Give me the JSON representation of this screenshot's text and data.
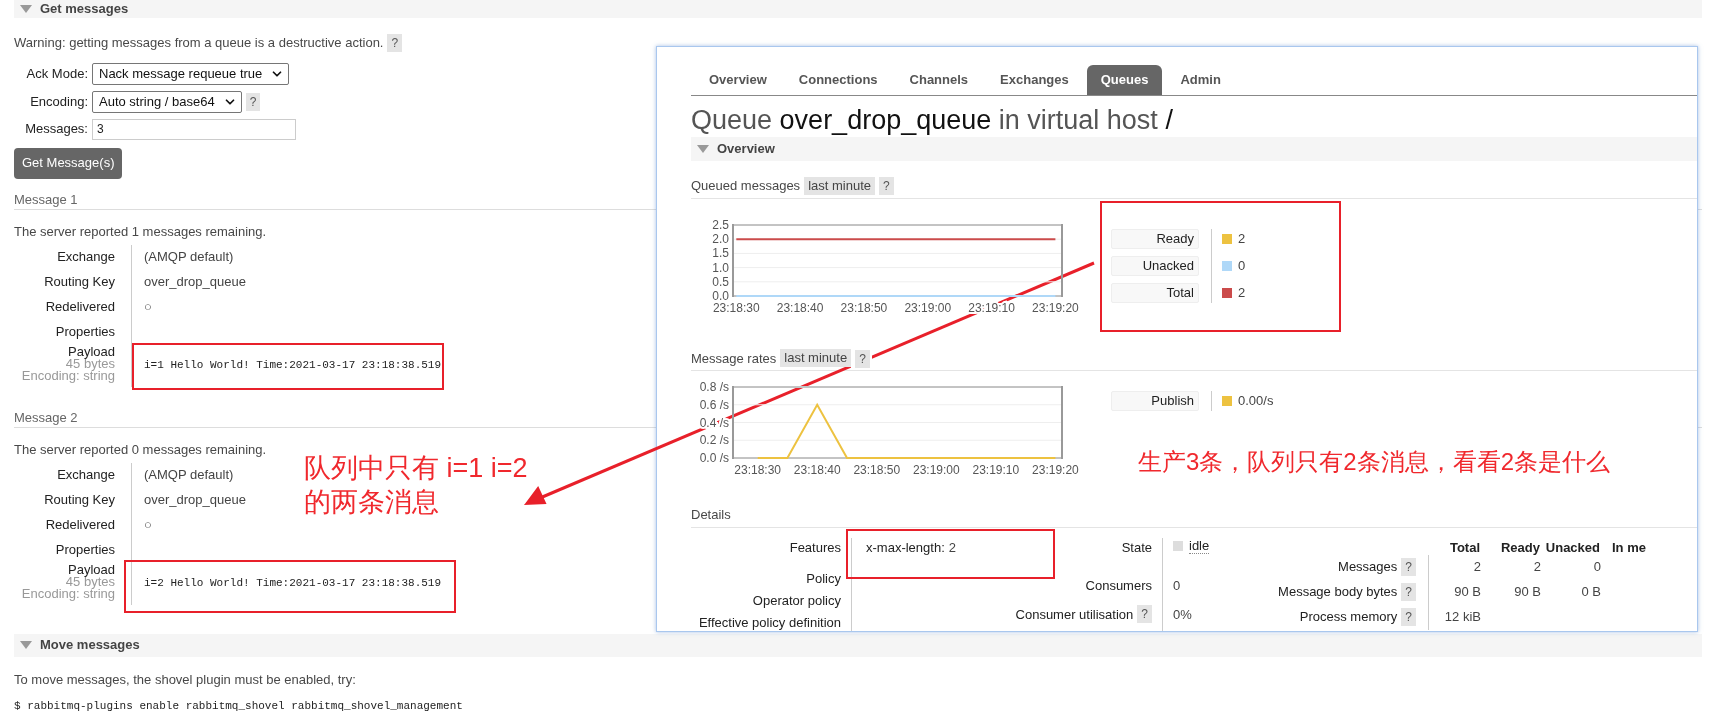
{
  "get_messages": {
    "section_title": "Get messages",
    "warning": "Warning: getting messages from a queue is a destructive action.",
    "warning_help": "?",
    "ack_mode": {
      "label": "Ack Mode:",
      "value": "Nack message requeue true"
    },
    "encoding": {
      "label": "Encoding:",
      "value": "Auto string / base64",
      "help": "?"
    },
    "messages": {
      "label": "Messages:",
      "value": "3"
    },
    "button": "Get Message(s)",
    "results": [
      {
        "title": "Message 1",
        "remaining": "The server reported 1 messages remaining.",
        "fields": [
          {
            "label": "Exchange",
            "value": "(AMQP default)"
          },
          {
            "label": "Routing Key",
            "value": "over_drop_queue"
          },
          {
            "label": "Redelivered",
            "value": "○"
          },
          {
            "label": "Properties"
          }
        ],
        "payload": {
          "label": "Payload",
          "size": "45 bytes",
          "encoding": "Encoding: string",
          "value": "i=1 Hello World! Time:2021-03-17 23:18:38.519"
        }
      },
      {
        "title": "Message 2",
        "remaining": "The server reported 0 messages remaining.",
        "fields": [
          {
            "label": "Exchange",
            "value": "(AMQP default)"
          },
          {
            "label": "Routing Key",
            "value": "over_drop_queue"
          },
          {
            "label": "Redelivered",
            "value": "○"
          },
          {
            "label": "Properties"
          }
        ],
        "payload": {
          "label": "Payload",
          "size": "45 bytes",
          "encoding": "Encoding: string",
          "value": "i=2 Hello World! Time:2021-03-17 23:18:38.519"
        }
      }
    ]
  },
  "move_messages": {
    "section_title": "Move messages",
    "text": "To move messages, the shovel plugin must be enabled, try:",
    "command": "$ rabbitmq-plugins enable rabbitmq_shovel rabbitmq_shovel_management"
  },
  "queue_window": {
    "tabs": [
      {
        "label": "Overview",
        "selected": false
      },
      {
        "label": "Connections",
        "selected": false
      },
      {
        "label": "Channels",
        "selected": false
      },
      {
        "label": "Exchanges",
        "selected": false
      },
      {
        "label": "Queues",
        "selected": true
      },
      {
        "label": "Admin",
        "selected": false
      }
    ],
    "title": {
      "prefix": "Queue",
      "name": "over_drop_queue",
      "middle": "in virtual host",
      "vhost": "/"
    },
    "section_title": "Overview",
    "queued": {
      "label": "Queued messages",
      "range": "last minute",
      "help": "?",
      "chart_data": {
        "type": "line",
        "grid": true,
        "categories": [
          "23:18:30",
          "23:18:40",
          "23:18:50",
          "23:19:00",
          "23:19:10",
          "23:19:20"
        ],
        "ylim": [
          0,
          2.5
        ],
        "yticks": [
          {
            "value": 0,
            "label": "0.0"
          },
          {
            "value": 0.5,
            "label": "0.5"
          },
          {
            "value": 1,
            "label": "1.0"
          },
          {
            "value": 1.5,
            "label": "1.5"
          },
          {
            "value": 2,
            "label": "2.0"
          },
          {
            "value": 2.5,
            "label": "2.5"
          }
        ],
        "series": [
          {
            "name": "Ready",
            "color": "#edc240",
            "values": [
              null,
              null,
              null,
              null,
              null,
              null
            ]
          },
          {
            "name": "Unacked",
            "color": "#afd8f8",
            "values": [
              0,
              0,
              0,
              0,
              0,
              0
            ]
          },
          {
            "name": "Total",
            "color": "#cb4b4b",
            "values": [
              2,
              2,
              2,
              2,
              2,
              2
            ]
          }
        ]
      },
      "legend_values": [
        "2",
        "0",
        "2"
      ]
    },
    "rates": {
      "label": "Message rates",
      "range": "last minute",
      "help": "?",
      "chart_data": {
        "type": "line",
        "grid": true,
        "categories": [
          "23:18:30",
          null,
          "23:18:40",
          null,
          "23:18:50",
          null,
          "23:19:00",
          null,
          "23:19:10",
          null,
          "23:19:20"
        ],
        "ylim": [
          0,
          0.8
        ],
        "yticks": [
          {
            "value": 0,
            "label": "0.0 /s"
          },
          {
            "value": 0.2,
            "label": "0.2 /s"
          },
          {
            "value": 0.4,
            "label": "0.4 /s"
          },
          {
            "value": 0.6,
            "label": "0.6 /s"
          },
          {
            "value": 0.8,
            "label": "0.8 /s"
          }
        ],
        "series": [
          {
            "name": "Publish",
            "color": "#edc240",
            "values": [
              0,
              0,
              0.6,
              0,
              0,
              0,
              0,
              0,
              0,
              0,
              0
            ]
          }
        ]
      },
      "legend_values": [
        "0.00/s"
      ]
    },
    "details": {
      "title": "Details",
      "column_a": [
        {
          "label": "Features",
          "key": "x-max-length:",
          "value": "2"
        },
        {
          "label": "Policy"
        },
        {
          "label": "Operator policy"
        },
        {
          "label": "Effective policy definition"
        }
      ],
      "column_b": [
        {
          "label": "State",
          "value": "idle",
          "kind": "state"
        },
        {
          "label": "Consumers",
          "value": "0",
          "kind": "plain"
        },
        {
          "label": "Consumer utilisation",
          "help": "?",
          "value": "0%",
          "kind": "plain"
        }
      ],
      "column_c": {
        "columns": [
          "Total",
          "Ready",
          "Unacked",
          "In me"
        ],
        "rows": [
          {
            "label": "Messages",
            "help": "?",
            "values": [
              "2",
              "2",
              "0"
            ]
          },
          {
            "label": "Message body bytes",
            "help": "?",
            "values": [
              "90 B",
              "90 B",
              "0 B"
            ]
          },
          {
            "label": "Process memory",
            "help": "?",
            "values": [
              "12 kiB"
            ]
          }
        ]
      }
    }
  },
  "annotations": {
    "note_left": [
      "队列中只有 i=1 i=2",
      "的两条消息"
    ],
    "note_right": "生产3条，队列只有2条消息，看看2条是什么"
  }
}
